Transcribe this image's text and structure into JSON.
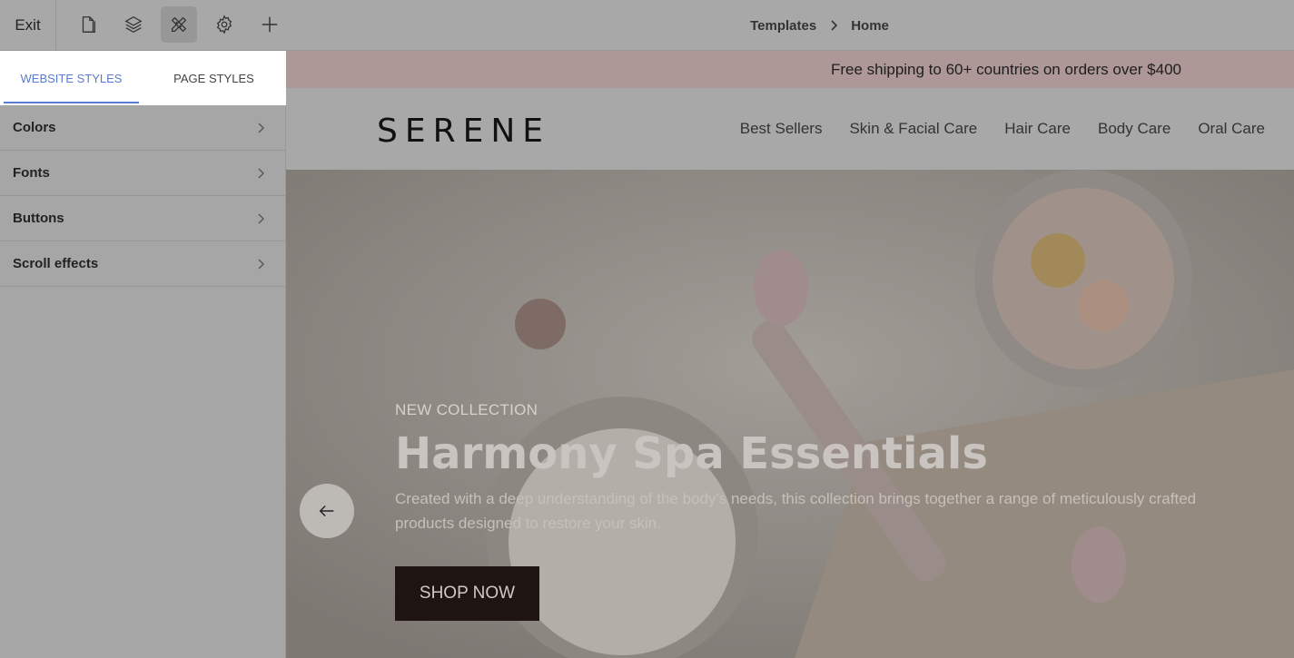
{
  "toolbar": {
    "exit_label": "Exit",
    "tools": [
      {
        "icon": "page-icon"
      },
      {
        "icon": "layers-icon"
      },
      {
        "icon": "design-tools-icon"
      },
      {
        "icon": "gear-icon"
      },
      {
        "icon": "plus-icon"
      }
    ]
  },
  "breadcrumb": {
    "parent": "Templates",
    "current": "Home"
  },
  "panel": {
    "tabs": [
      {
        "label": "WEBSITE STYLES",
        "active": true
      },
      {
        "label": "PAGE STYLES",
        "active": false
      }
    ],
    "items": [
      {
        "label": "Colors"
      },
      {
        "label": "Fonts"
      },
      {
        "label": "Buttons"
      },
      {
        "label": "Scroll effects"
      }
    ]
  },
  "site": {
    "promo": "Free shipping to 60+ countries on orders over $400",
    "logo": "SERENE",
    "nav": [
      "Best Sellers",
      "Skin & Facial Care",
      "Hair Care",
      "Body Care",
      "Oral Care"
    ],
    "hero": {
      "eyebrow": "NEW COLLECTION",
      "title": "Harmony Spa Essentials",
      "description": "Created with a deep understanding of the body's needs, this collection brings together a range of meticulously crafted products designed to restore your skin.",
      "cta": "SHOP NOW"
    }
  },
  "colors": {
    "accent": "#5a7bd4",
    "promo_bg": "#ad9797",
    "cta_bg": "#1e1412"
  }
}
